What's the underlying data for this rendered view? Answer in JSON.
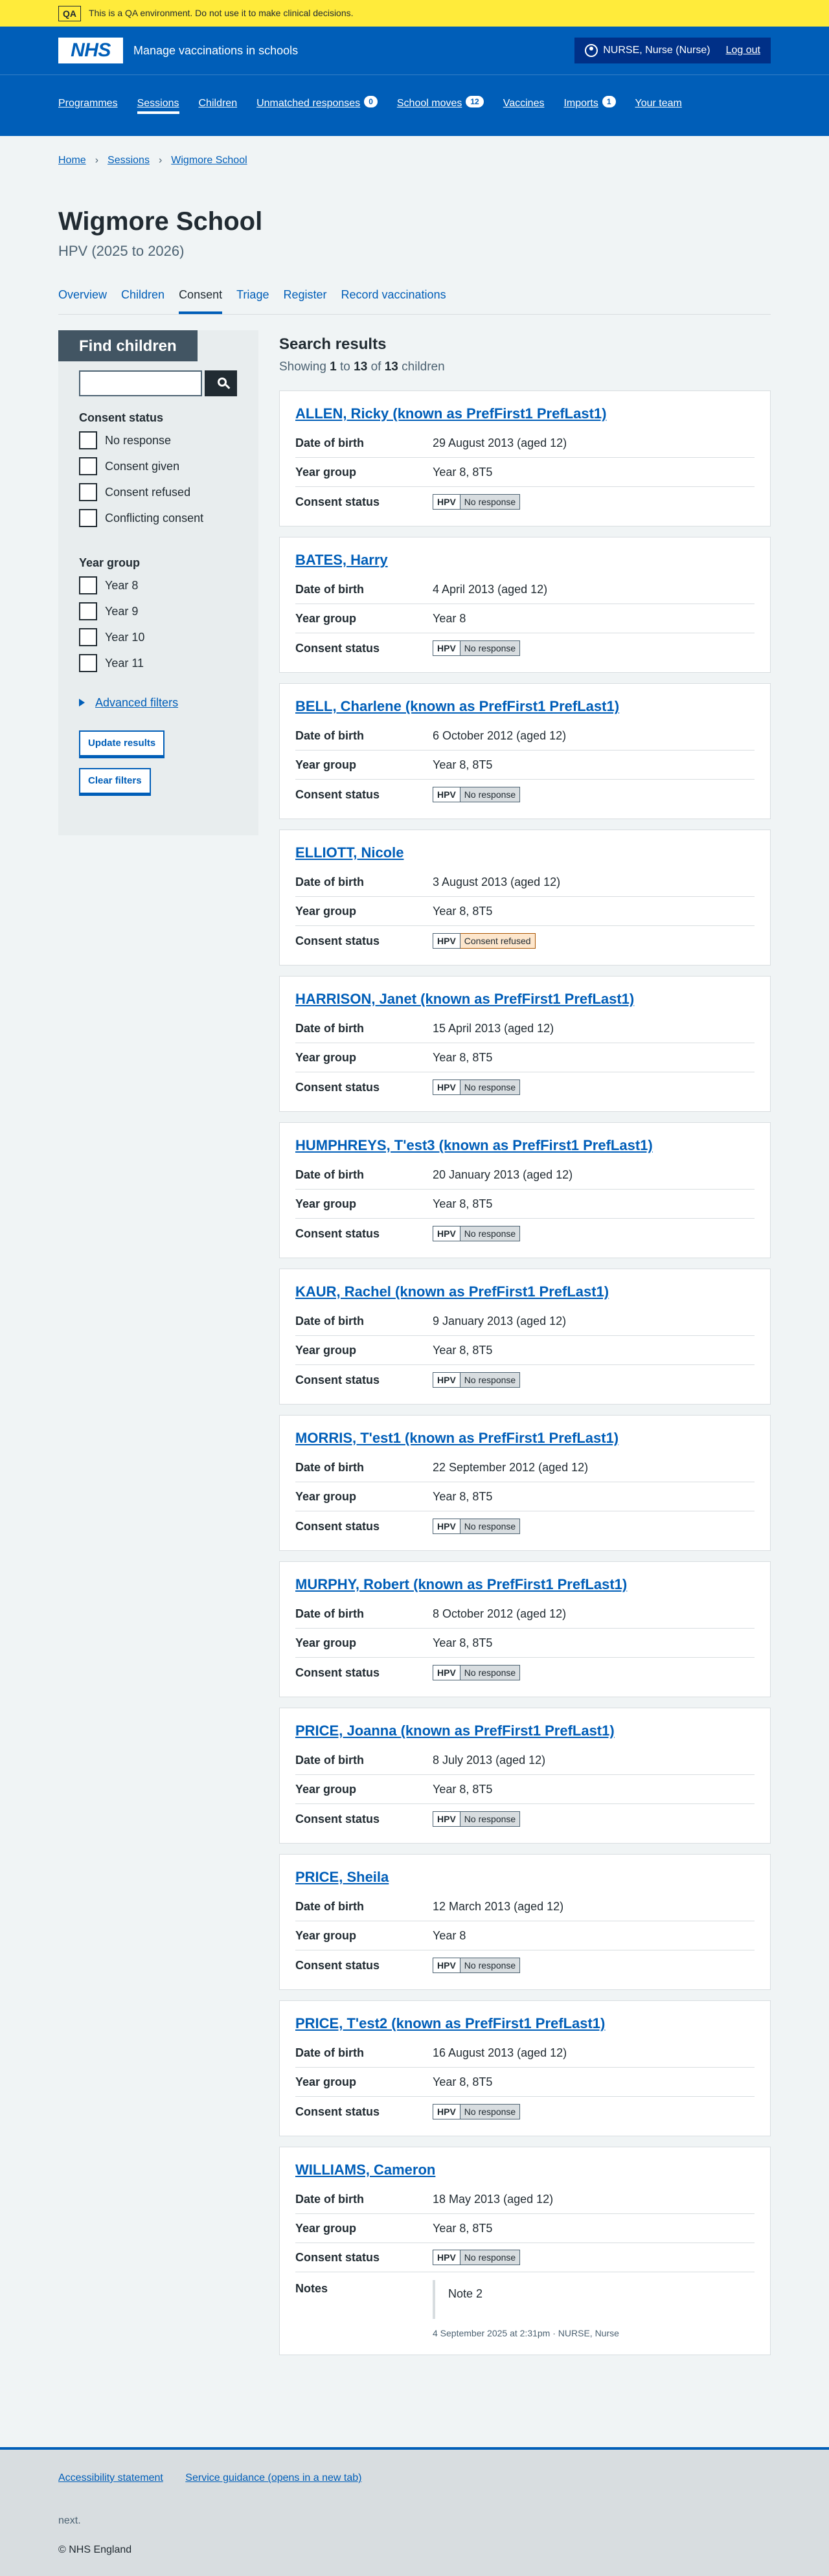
{
  "qa_banner": {
    "tag": "QA",
    "text": "This is a QA environment. Do not use it to make clinical decisions."
  },
  "header": {
    "logo": "NHS",
    "service_name": "Manage vaccinations in schools",
    "account_name": "NURSE, Nurse (Nurse)",
    "logout": "Log out",
    "nav": [
      {
        "label": "Programmes"
      },
      {
        "label": "Sessions"
      },
      {
        "label": "Children"
      },
      {
        "label": "Unmatched responses",
        "count": "0"
      },
      {
        "label": "School moves",
        "count": "12"
      },
      {
        "label": "Vaccines"
      },
      {
        "label": "Imports",
        "count": "1"
      },
      {
        "label": "Your team"
      }
    ]
  },
  "breadcrumb": [
    "Home",
    "Sessions",
    "Wigmore School"
  ],
  "page": {
    "title": "Wigmore School",
    "caption": "HPV (2025 to 2026)"
  },
  "tabs": [
    "Overview",
    "Children",
    "Consent",
    "Triage",
    "Register",
    "Record vaccinations"
  ],
  "filters": {
    "heading": "Find children",
    "search_placeholder": "",
    "consent_legend": "Consent status",
    "consent_options": [
      "No response",
      "Consent given",
      "Consent refused",
      "Conflicting consent"
    ],
    "year_legend": "Year group",
    "year_options": [
      "Year 8",
      "Year 9",
      "Year 10",
      "Year 11"
    ],
    "advanced": "Advanced filters",
    "update": "Update results",
    "clear": "Clear filters"
  },
  "results": {
    "heading": "Search results",
    "count_prefix": "Showing",
    "from": "1",
    "to_word": "to",
    "to": "13",
    "of_word": "of",
    "total": "13",
    "suffix": "children",
    "labels": {
      "dob": "Date of birth",
      "year": "Year group",
      "consent": "Consent status",
      "notes": "Notes"
    },
    "programme": "HPV",
    "children": [
      {
        "name": "ALLEN, Ricky (known as PrefFirst1 PrefLast1)",
        "dob": "29 August 2013 (aged 12)",
        "year": "Year 8, 8T5",
        "status": "No response"
      },
      {
        "name": "BATES, Harry",
        "dob": "4 April 2013 (aged 12)",
        "year": "Year 8",
        "status": "No response"
      },
      {
        "name": "BELL, Charlene (known as PrefFirst1 PrefLast1)",
        "dob": "6 October 2012 (aged 12)",
        "year": "Year 8, 8T5",
        "status": "No response"
      },
      {
        "name": "ELLIOTT, Nicole",
        "dob": "3 August 2013 (aged 12)",
        "year": "Year 8, 8T5",
        "status": "Consent refused"
      },
      {
        "name": "HARRISON, Janet (known as PrefFirst1 PrefLast1)",
        "dob": "15 April 2013 (aged 12)",
        "year": "Year 8, 8T5",
        "status": "No response"
      },
      {
        "name": "HUMPHREYS, T'est3 (known as PrefFirst1 PrefLast1)",
        "dob": "20 January 2013 (aged 12)",
        "year": "Year 8, 8T5",
        "status": "No response"
      },
      {
        "name": "KAUR, Rachel (known as PrefFirst1 PrefLast1)",
        "dob": "9 January 2013 (aged 12)",
        "year": "Year 8, 8T5",
        "status": "No response"
      },
      {
        "name": "MORRIS, T'est1 (known as PrefFirst1 PrefLast1)",
        "dob": "22 September 2012 (aged 12)",
        "year": "Year 8, 8T5",
        "status": "No response"
      },
      {
        "name": "MURPHY, Robert (known as PrefFirst1 PrefLast1)",
        "dob": "8 October 2012 (aged 12)",
        "year": "Year 8, 8T5",
        "status": "No response"
      },
      {
        "name": "PRICE, Joanna (known as PrefFirst1 PrefLast1)",
        "dob": "8 July 2013 (aged 12)",
        "year": "Year 8, 8T5",
        "status": "No response"
      },
      {
        "name": "PRICE, Sheila",
        "dob": "12 March 2013 (aged 12)",
        "year": "Year 8",
        "status": "No response"
      },
      {
        "name": "PRICE, T'est2 (known as PrefFirst1 PrefLast1)",
        "dob": "16 August 2013 (aged 12)",
        "year": "Year 8, 8T5",
        "status": "No response"
      },
      {
        "name": "WILLIAMS, Cameron",
        "dob": "18 May 2013 (aged 12)",
        "year": "Year 8, 8T5",
        "status": "No response",
        "note": "Note 2",
        "note_meta": "4 September 2025 at 2:31pm · NURSE, Nurse"
      }
    ]
  },
  "footer": {
    "links": [
      "Accessibility statement",
      "Service guidance (opens in a new tab)"
    ],
    "next": "next.",
    "copyright": "© NHS England"
  },
  "colors": {
    "brand_blue": "#005eb8",
    "qa_yellow": "#ffeb3b",
    "dark_blue": "#003087"
  }
}
